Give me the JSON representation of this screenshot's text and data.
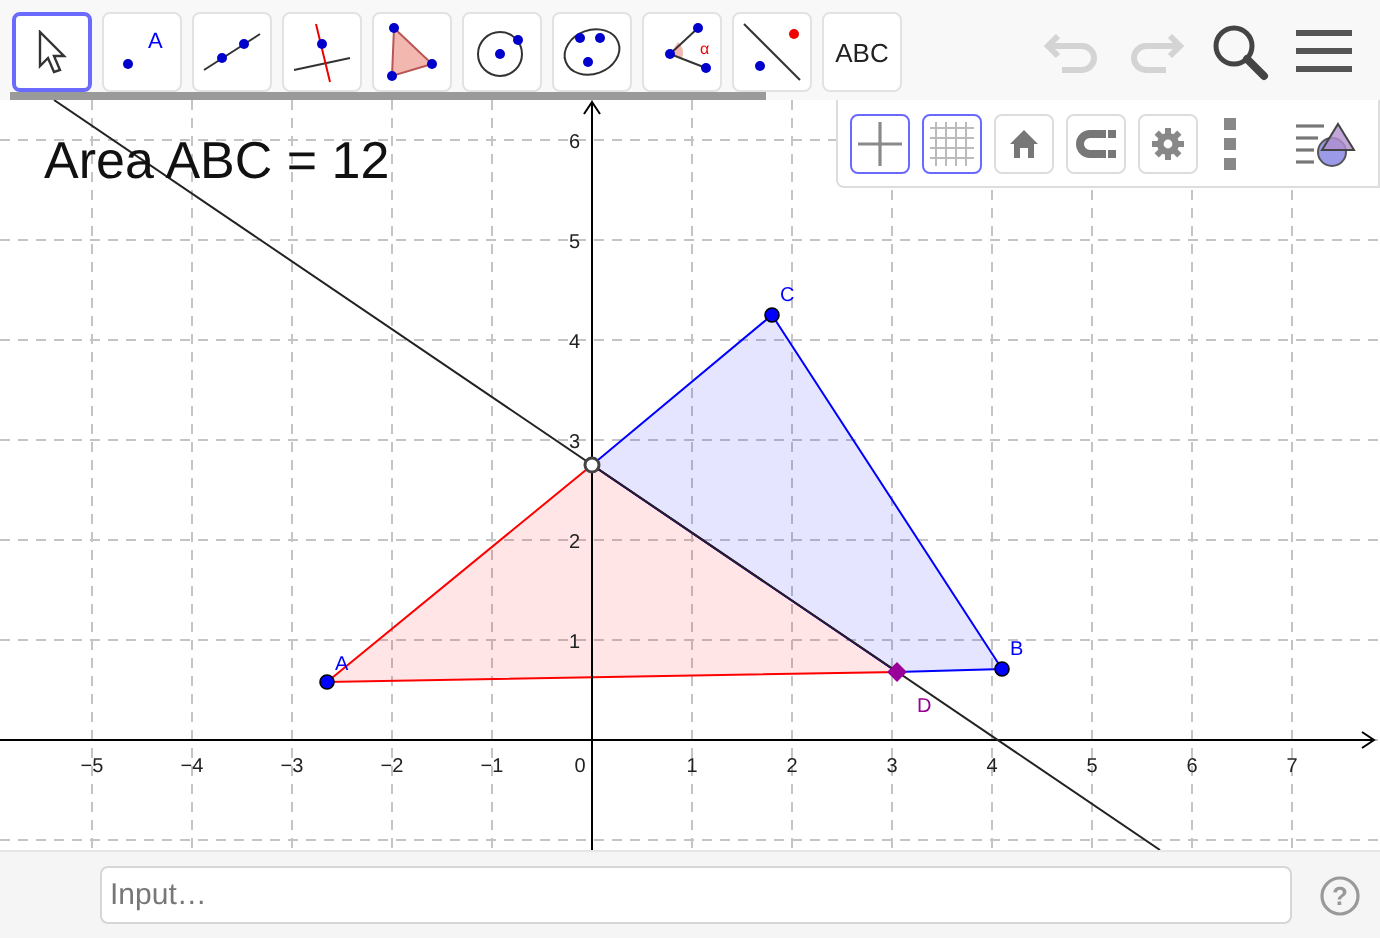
{
  "toolbar": {
    "tools": [
      {
        "kind": "move",
        "selected": true
      },
      {
        "kind": "point",
        "selected": false,
        "label": "A"
      },
      {
        "kind": "line",
        "selected": false
      },
      {
        "kind": "perpendicular",
        "selected": false
      },
      {
        "kind": "polygon",
        "selected": false
      },
      {
        "kind": "circle",
        "selected": false
      },
      {
        "kind": "conic",
        "selected": false
      },
      {
        "kind": "angle",
        "selected": false,
        "label": "α"
      },
      {
        "kind": "reflect",
        "selected": false
      },
      {
        "kind": "text",
        "selected": false,
        "label": "ABC"
      }
    ],
    "undo": {
      "disabled": true
    },
    "redo": {
      "disabled": true
    }
  },
  "style_bar": {
    "buttons": [
      {
        "kind": "axes",
        "selected": true
      },
      {
        "kind": "grid",
        "selected": true
      },
      {
        "kind": "home",
        "selected": false
      },
      {
        "kind": "magnet",
        "selected": false
      },
      {
        "kind": "settings",
        "selected": false
      },
      {
        "kind": "more"
      },
      {
        "kind": "views"
      }
    ]
  },
  "graphics": {
    "caption": "Area ABC = 12",
    "x_ticks": [
      "−5",
      "−4",
      "−3",
      "−2",
      "−1",
      "0",
      "1",
      "2",
      "3",
      "4",
      "5",
      "6",
      "7"
    ],
    "y_ticks": [
      "6",
      "5",
      "4",
      "3",
      "2",
      "1"
    ],
    "polygons": [
      {
        "kind": "triangle",
        "color": "#ff0000"
      },
      {
        "kind": "quadrilateral",
        "color": "#0000ff"
      }
    ],
    "points": [
      {
        "label": "A",
        "color": "#0000ff"
      },
      {
        "label": "B",
        "color": "#0000ff"
      },
      {
        "label": "C",
        "color": "#0000ff"
      },
      {
        "label": "D",
        "color": "#990099"
      }
    ]
  },
  "input_bar": {
    "placeholder": "Input…",
    "help": "?"
  }
}
